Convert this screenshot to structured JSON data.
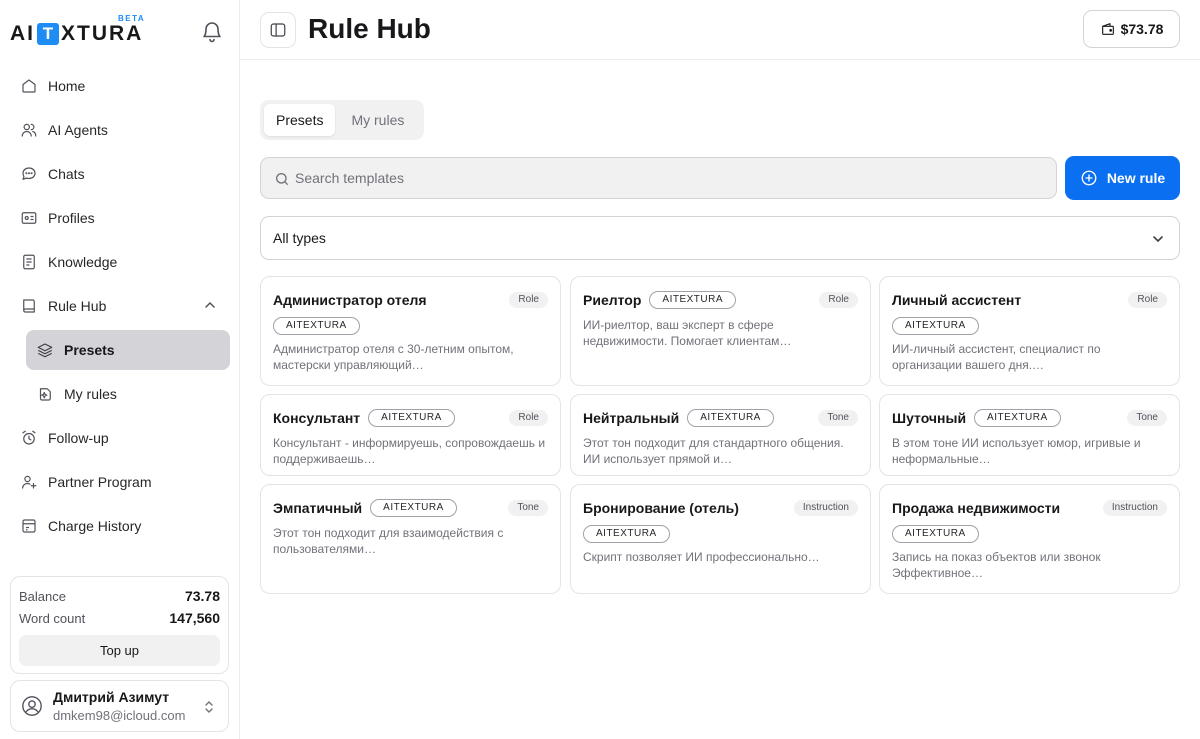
{
  "brand": {
    "logo_left": "AI",
    "logo_t": "T",
    "logo_right": "XTURA",
    "beta": "BETA"
  },
  "sidebar": {
    "items": [
      {
        "label": "Home",
        "icon": "home-icon"
      },
      {
        "label": "AI Agents",
        "icon": "users-icon"
      },
      {
        "label": "Chats",
        "icon": "chat-bubble-icon"
      },
      {
        "label": "Profiles",
        "icon": "id-card-icon"
      },
      {
        "label": "Knowledge",
        "icon": "document-icon"
      },
      {
        "label": "Rule Hub",
        "icon": "book-icon"
      },
      {
        "label": "Presets",
        "icon": "layers-icon"
      },
      {
        "label": "My rules",
        "icon": "rule-sparkle-icon"
      },
      {
        "label": "Follow-up",
        "icon": "alarm-clock-icon"
      },
      {
        "label": "Partner Program",
        "icon": "user-plus-icon"
      },
      {
        "label": "Charge History",
        "icon": "receipt-icon"
      }
    ],
    "balance": {
      "balance_label": "Balance",
      "balance_value": "73.78",
      "words_label": "Word count",
      "words_value": "147,560",
      "topup_label": "Top up"
    },
    "user": {
      "name": "Дмитрий Азимут",
      "email": "dmkem98@icloud.com"
    }
  },
  "header": {
    "title": "Rule Hub",
    "wallet": "$73.78"
  },
  "tabs": [
    {
      "label": "Presets",
      "active": true
    },
    {
      "label": "My rules",
      "active": false
    }
  ],
  "search": {
    "placeholder": "Search templates"
  },
  "new_rule_label": "New rule",
  "type_filter": {
    "selected": "All types"
  },
  "cards": [
    {
      "title": "Администратор отеля",
      "brand": "AITEXTURA",
      "type": "Role",
      "desc": "Администратор отеля с 30-летним опытом, мастерски управляющий…"
    },
    {
      "title": "Риелтор",
      "brand": "AITEXTURA",
      "type": "Role",
      "desc": "ИИ-риелтор, ваш эксперт в сфере недвижимости. Помогает клиентам…"
    },
    {
      "title": "Личный ассистент",
      "brand": "AITEXTURA",
      "type": "Role",
      "desc": "ИИ-личный ассистент, специалист по организации вашего дня.…"
    },
    {
      "title": "Консультант",
      "brand": "AITEXTURA",
      "type": "Role",
      "desc": "Консультант - информируешь, сопровождаешь и поддерживаешь…"
    },
    {
      "title": "Нейтральный",
      "brand": "AITEXTURA",
      "type": "Tone",
      "desc": "Этот тон подходит для стандартного общения. ИИ использует прямой и…"
    },
    {
      "title": "Шуточный",
      "brand": "AITEXTURA",
      "type": "Tone",
      "desc": "В этом тоне ИИ использует юмор, игривые и неформальные…"
    },
    {
      "title": "Эмпатичный",
      "brand": "AITEXTURA",
      "type": "Tone",
      "desc": "Этот тон подходит для взаимодействия с пользователями…"
    },
    {
      "title": "Бронирование (отель)",
      "brand": "AITEXTURA",
      "type": "Instruction",
      "desc": "Скрипт позволяет ИИ профессионально…"
    },
    {
      "title": "Продажа недвижимости",
      "brand": "AITEXTURA",
      "type": "Instruction",
      "desc": "Запись на показ объектов или звонок Эффективное…"
    }
  ],
  "colors": {
    "accent": "#0a6ff0",
    "logo_blue": "#1e8cf5",
    "active_nav": "#d4d4d8"
  }
}
